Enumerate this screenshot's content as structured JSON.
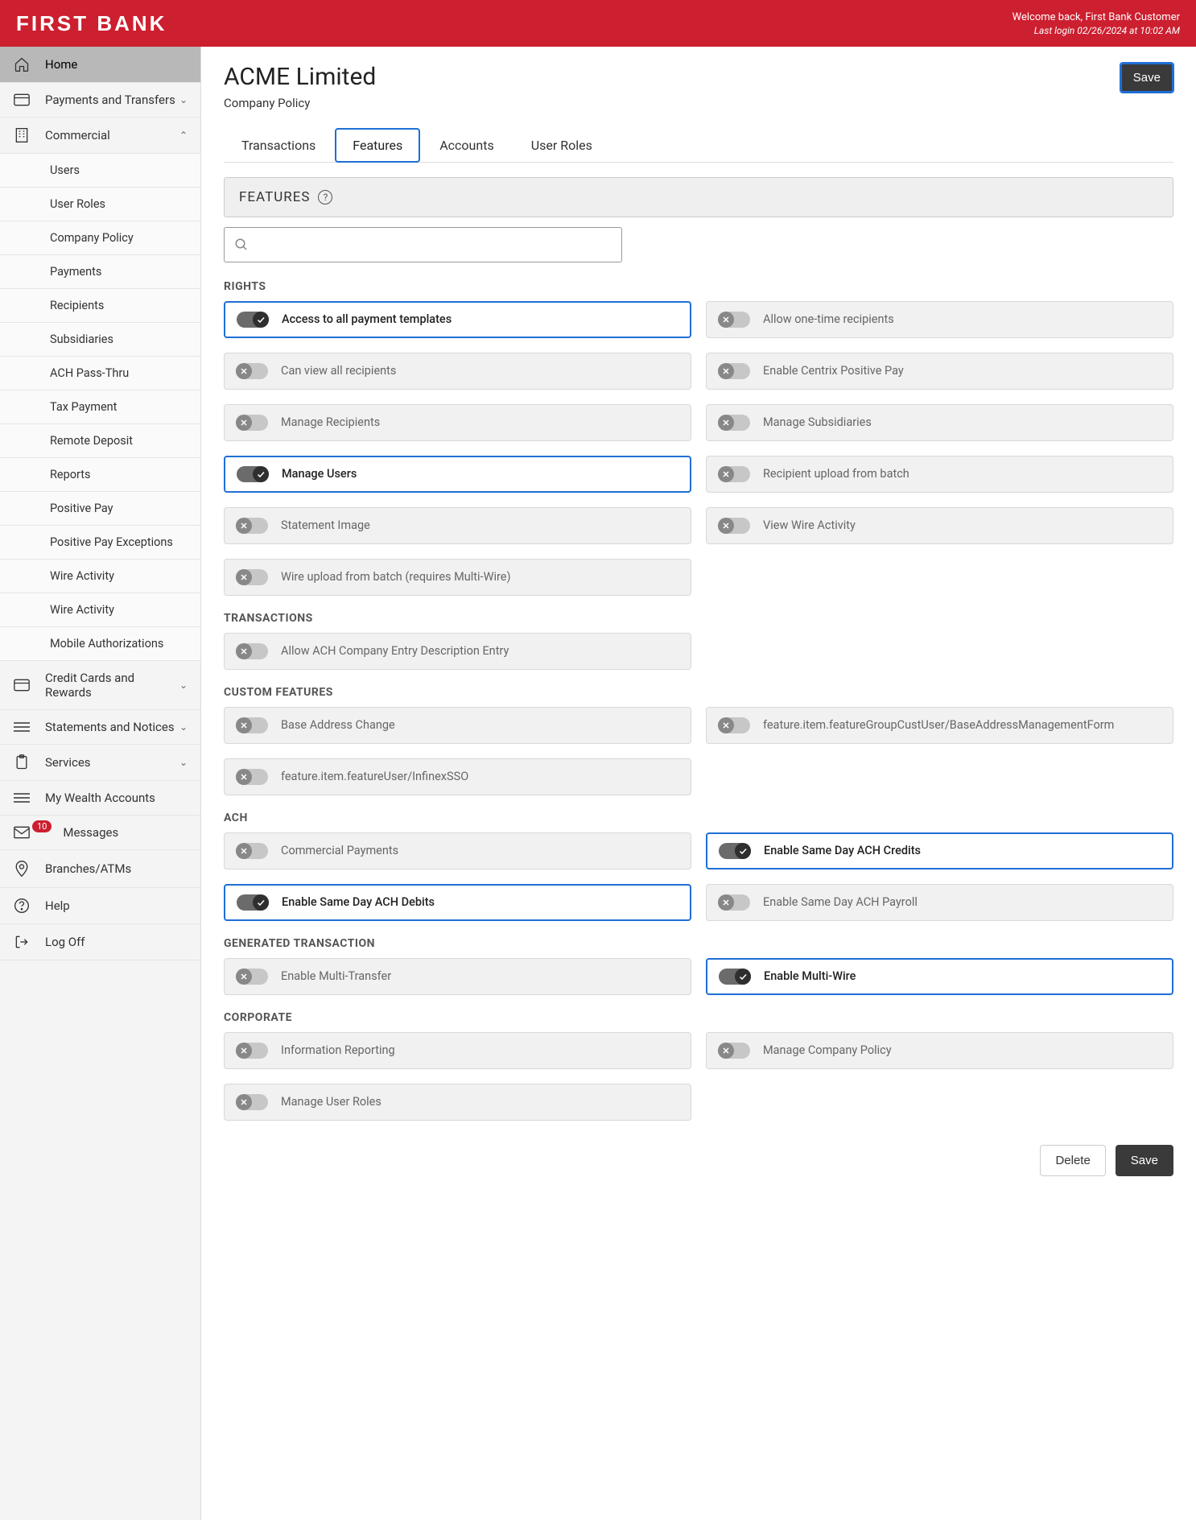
{
  "header": {
    "logo": "FIRST BANK",
    "welcome": "Welcome back, First Bank Customer",
    "last_login": "Last login 02/26/2024 at 10:02 AM"
  },
  "sidebar": {
    "home": "Home",
    "payments_transfers": "Payments and Transfers",
    "commercial": "Commercial",
    "commercial_sub": [
      "Users",
      "User Roles",
      "Company Policy",
      "Payments",
      "Recipients",
      "Subsidiaries",
      "ACH Pass-Thru",
      "Tax Payment",
      "Remote Deposit",
      "Reports",
      "Positive Pay",
      "Positive Pay Exceptions",
      "Wire Activity",
      "Wire Activity",
      "Mobile Authorizations"
    ],
    "credit_cards": "Credit Cards and Rewards",
    "statements": "Statements and Notices",
    "services": "Services",
    "my_wealth": "My Wealth Accounts",
    "messages": "Messages",
    "messages_badge": "10",
    "branches": "Branches/ATMs",
    "help": "Help",
    "logoff": "Log Off"
  },
  "page": {
    "title": "ACME Limited",
    "subtitle": "Company Policy",
    "save_top": "Save"
  },
  "tabs": {
    "transactions": "Transactions",
    "features": "Features",
    "accounts": "Accounts",
    "user_roles": "User Roles"
  },
  "features_bar": "FEATURES",
  "groups": {
    "rights": {
      "heading": "RIGHTS",
      "items": [
        {
          "label": "Access to all payment templates",
          "on": true
        },
        {
          "label": "Allow one-time recipients",
          "on": false
        },
        {
          "label": "Can view all recipients",
          "on": false
        },
        {
          "label": "Enable Centrix Positive Pay",
          "on": false
        },
        {
          "label": "Manage Recipients",
          "on": false
        },
        {
          "label": "Manage Subsidiaries",
          "on": false
        },
        {
          "label": "Manage Users",
          "on": true
        },
        {
          "label": "Recipient upload from batch",
          "on": false
        },
        {
          "label": "Statement Image",
          "on": false
        },
        {
          "label": "View Wire Activity",
          "on": false
        },
        {
          "label": "Wire upload from batch (requires Multi-Wire)",
          "on": false
        }
      ]
    },
    "transactions": {
      "heading": "TRANSACTIONS",
      "items": [
        {
          "label": "Allow ACH Company Entry Description Entry",
          "on": false
        }
      ]
    },
    "custom": {
      "heading": "CUSTOM FEATURES",
      "items": [
        {
          "label": "Base Address Change",
          "on": false
        },
        {
          "label": "feature.item.featureGroupCustUser/BaseAddressManagementForm",
          "on": false
        },
        {
          "label": "feature.item.featureUser/InfinexSSO",
          "on": false
        }
      ]
    },
    "ach": {
      "heading": "ACH",
      "items": [
        {
          "label": "Commercial Payments",
          "on": false
        },
        {
          "label": "Enable Same Day ACH Credits",
          "on": true
        },
        {
          "label": "Enable Same Day ACH Debits",
          "on": true
        },
        {
          "label": "Enable Same Day ACH Payroll",
          "on": false
        }
      ]
    },
    "generated": {
      "heading": "GENERATED TRANSACTION",
      "items": [
        {
          "label": "Enable Multi-Transfer",
          "on": false
        },
        {
          "label": "Enable Multi-Wire",
          "on": true
        }
      ]
    },
    "corporate": {
      "heading": "CORPORATE",
      "items": [
        {
          "label": "Information Reporting",
          "on": false
        },
        {
          "label": "Manage Company Policy",
          "on": false
        },
        {
          "label": "Manage User Roles",
          "on": false
        }
      ]
    }
  },
  "footer": {
    "delete": "Delete",
    "save": "Save"
  }
}
